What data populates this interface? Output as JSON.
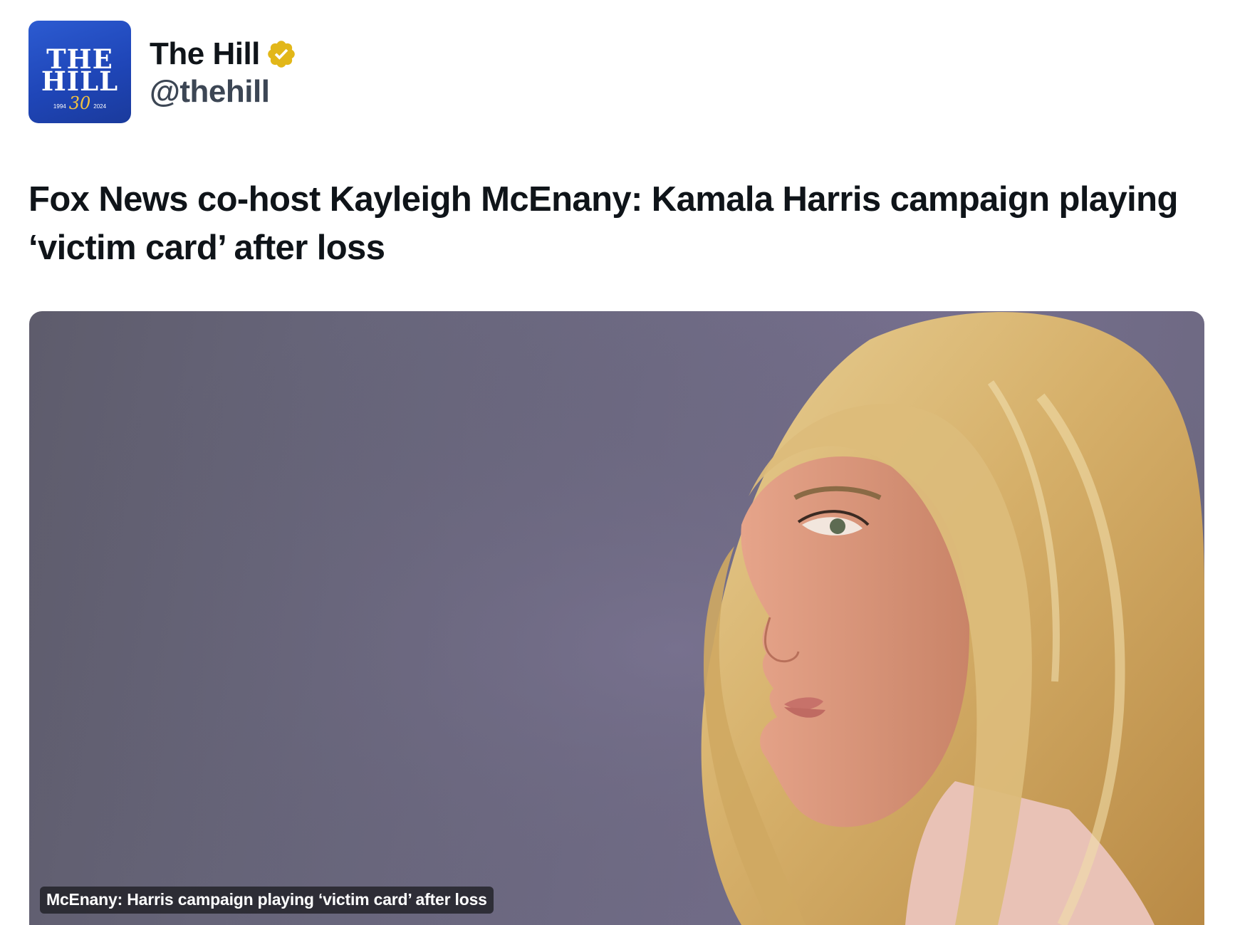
{
  "post": {
    "author": {
      "display_name": "The Hill",
      "handle": "@thehill",
      "verified_badge_color": "#e2b719",
      "avatar": {
        "logo_line1": "THE",
        "logo_line2": "HILL",
        "year_start": "1994",
        "anniversary": "30",
        "year_end": "2024",
        "background": "#2450c4"
      }
    },
    "headline": "Fox News co-host Kayleigh McEnany: Kamala Harris campaign playing ‘victim card’ after loss",
    "link_card": {
      "image_description_icon": "photo-of-woman-profile",
      "caption": "McEnany: Harris campaign playing ‘victim card’ after loss"
    }
  }
}
